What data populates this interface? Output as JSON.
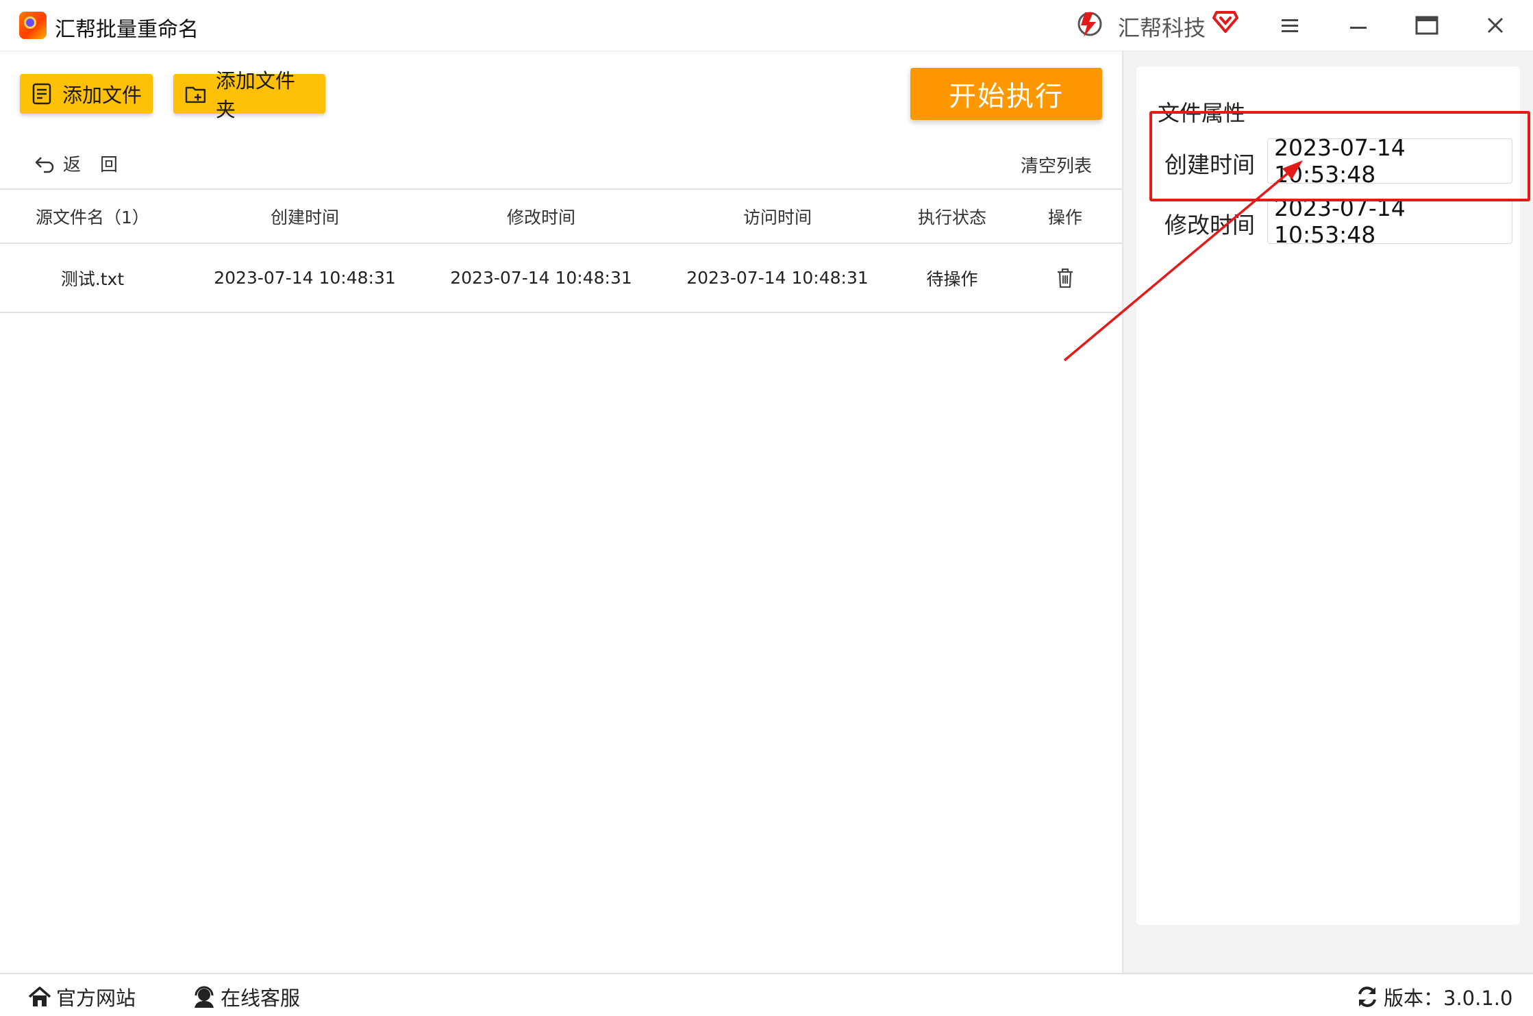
{
  "app": {
    "title": "汇帮批量重命名",
    "brand_name": "汇帮科技",
    "icons": [
      "app-logo-icon",
      "brand-logo-icon",
      "vip-icon",
      "menu-icon",
      "minimize-icon",
      "maximize-icon",
      "close-icon"
    ]
  },
  "toolbar": {
    "add_file_label": "添加文件",
    "add_folder_label": "添加文件夹",
    "start_label": "开始执行",
    "back_label": "返回",
    "clear_label": "清空列表"
  },
  "table": {
    "headers": [
      "源文件名（1）",
      "创建时间",
      "修改时间",
      "访问时间",
      "执行状态",
      "操作"
    ],
    "rows": [
      {
        "name": "测试.txt",
        "created": "2023-07-14 10:48:31",
        "modified": "2023-07-14 10:48:31",
        "accessed": "2023-07-14 10:48:31",
        "status": "待操作",
        "action_icon": "trash-icon"
      }
    ]
  },
  "panel": {
    "title": "文件属性",
    "created_label": "创建时间",
    "created_value": "2023-07-14 10:53:48",
    "modified_label": "修改时间",
    "modified_value": "2023-07-14 10:53:48"
  },
  "footer": {
    "website_label": "官方网站",
    "support_label": "在线客服",
    "version_label": "版本：3.0.1.0"
  },
  "colors": {
    "button_yellow": "#ffc107",
    "button_orange": "#ff9800",
    "annotation_red": "#e21a1a"
  }
}
